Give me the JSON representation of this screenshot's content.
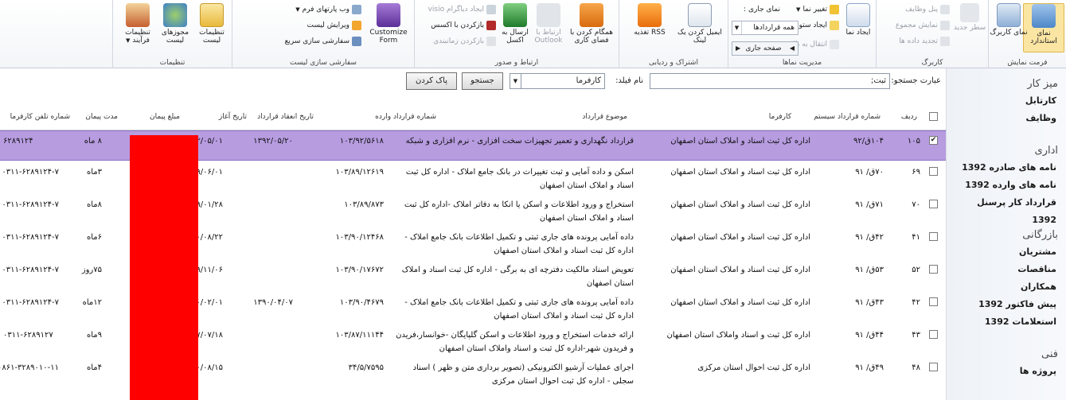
{
  "ribbon": {
    "groups": {
      "view_format": "فرمت نمایش",
      "datasheet": "کاربرگ",
      "manage_views": "مدیریت نماها",
      "share_track": "اشتراک و ردیابی",
      "connect_export": "ارتباط و صدور",
      "customize_list": "سفارشی سازی لیست",
      "settings": "تنظیمات"
    },
    "standard_view": "نمای استاندارد",
    "datasheet_view": "نمای کاربرگ",
    "new_row": "سطر جدید",
    "show_taskpane": "پنل وظایف",
    "show_totals": "نمایش مجموع",
    "refresh_data": "تجدید داده ها",
    "create_view": "ایجاد نما",
    "modify_view": "تغییر نما",
    "create_column": "ایجاد ستون",
    "navigate_up": "انتقال به بالا",
    "current_view_label": "نمای جاری :",
    "current_view_value": "همه قراردادها",
    "current_page": "صفحه جاری",
    "email_link": "ایمیل کردن یک لینک",
    "rss_feed": "RSS تغذیه",
    "sync_sharepoint": "همگام کردن با فضای کاری",
    "connect_outlook": "ارتباط با Outlook",
    "export_excel": "ارسال به اکسل",
    "visio_diagram": "ایجاد دیاگرام visio",
    "open_access": "بازکردن با اکسس",
    "open_project": "بازکردن زمانبندی",
    "customize_form": "Customize Form",
    "form_webparts": "وب پارتهای فرم",
    "edit_list": "ویرایش لیست",
    "quick_customize": "سفارشی سازی سریع",
    "list_settings": "تنظیمات لیست",
    "list_permissions": "مجوزهای لیست",
    "workflow_settings": "تنظیمات فرآیند"
  },
  "nav": {
    "sections": [
      {
        "heading": "میز کار",
        "items": [
          "کارتابل",
          "وظایف"
        ]
      },
      {
        "heading": "اداری",
        "items": [
          "نامه های صادره 1392",
          "نامه های وارده 1392",
          "قرارداد کار پرسنل 1392"
        ]
      },
      {
        "heading": "بازرگانی",
        "items": [
          "مشتریان",
          "مناقصات",
          "همکاران",
          "پیش فاکتور 1392",
          "استعلامات 1392"
        ]
      },
      {
        "heading": "فنی",
        "items": [
          "پروژه ها"
        ]
      }
    ]
  },
  "search": {
    "phrase_label": "عبارت جستجو:",
    "phrase_value": "ثبت;",
    "field_label": "نام فیلد:",
    "field_value": "کارفرما",
    "search_button": "جستجو",
    "clear_button": "پاک کردن"
  },
  "table": {
    "headers": {
      "row": "ردیف",
      "sys_no": "شماره قرارداد سیستم",
      "employer": "کارفرما",
      "subject": "موضوع قرارداد",
      "incoming_no": "شماره قرارداد وارده",
      "sign_date": "تاریخ انعقاد قرارداد",
      "start_date": "تاریخ آغاز",
      "amount": "مبلغ پیمان",
      "duration": "مدت پیمان",
      "phone": "شماره تلفن کارفرما"
    },
    "rows": [
      {
        "checked": "✔",
        "row": "۱۰۵",
        "sys_no": "۱۰۴ق/۹۲",
        "employer": "اداره کل ثبت اسناد و املاک استان اصفهان",
        "subject": "قرارداد نگهداری و تعمیر تجهیزات سخت افزاری - نرم افزاری و شبکه",
        "incoming_no": "۱۰۳/۹۲/۵۶۱۸",
        "sign_date": "۱۳۹۲/۰۵/۲۰",
        "start_date": "۱۳۹۲/۰۵/۰۱",
        "duration": "۸ ماه",
        "phone": "۶۲۸۹۱۲۴"
      },
      {
        "checked": "",
        "row": "۶۹",
        "sys_no": "۷۰ق/ ۹۱",
        "employer": "اداره کل ثبت اسناد و املاک استان اصفهان",
        "subject": "اسکن و داده آمایی و ثبت تغییرات در بانک جامع املاک - اداره کل ثبت اسناد و املاک استان اصفهان",
        "incoming_no": "۱۰۳/۸۹/۱۲۶۱۹",
        "sign_date": "",
        "start_date": "۱۳۸۹/۰۶/۰۱",
        "duration": "۳ماه",
        "phone": "۰۳۱۱-۶۲۸۹۱۲۴-۷"
      },
      {
        "checked": "",
        "row": "۷۰",
        "sys_no": "۷۱ق/ ۹۱",
        "employer": "اداره کل ثبت اسناد و املاک استان اصفهان",
        "subject": "استخراج و ورود اطلاعات و اسکن یا انکا به دفاتر املاک -اداره کل ثبت اسناد و املاک استان اصفهان",
        "incoming_no": "۱۰۳/۸۹/۸۷۳",
        "sign_date": "",
        "start_date": "۱۳۸۹/۰۱/۲۸",
        "duration": "۸ماه",
        "phone": "۰۳۱۱-۶۲۸۹۱۲۴-۷"
      },
      {
        "checked": "",
        "row": "۴۱",
        "sys_no": "۴۲ق/ ۹۱",
        "employer": "اداره کل ثبت اسناد و املاک استان اصفهان",
        "subject": "داده آمایی پرونده های جاری ثبتی و تکمیل اطلاعات بانک جامع املاک - اداره کل ثبت اسناد و املاک استان اصفهان",
        "incoming_no": "۱۰۳/۹۰/۱۲۴۶۸",
        "sign_date": "",
        "start_date": "۱۳۹۰/۰۸/۲۲",
        "duration": "۶ماه",
        "phone": "۰۳۱۱-۶۲۸۹۱۲۴-۷"
      },
      {
        "checked": "",
        "row": "۵۲",
        "sys_no": "۵۳ق/ ۹۱",
        "employer": "اداره کل ثبت اسناد و املاک استان اصفهان",
        "subject": "تعویض اسناد مالکیت دفترچه ای به برگی - اداره کل ثبت اسناد و املاک استان اصفهان",
        "incoming_no": "۱۰۳/۹۰/۱۷۶۷۲",
        "sign_date": "",
        "start_date": "۱۳۸۹/۱۱/۰۶",
        "duration": "۷۵روز",
        "phone": "۰۳۱۱-۶۲۸۹۱۲۴-۷"
      },
      {
        "checked": "",
        "row": "۴۲",
        "sys_no": "۴۳ق/ ۹۱",
        "employer": "اداره کل ثبت اسناد و املاک استان اصفهان",
        "subject": "داده آمایی پرونده های جاری ثبتی و تکمیل اطلاعات بانک جامع املاک - اداره کل ثبت اسناد و املاک استان اصفهان",
        "incoming_no": "۱۰۳/۹۰/۴۶۷۹",
        "sign_date": "۱۳۹۰/۰۴/۰۷",
        "start_date": "۱۳۹۰/۰۲/۰۱",
        "duration": "۱۲ماه",
        "phone": "۰۳۱۱-۶۲۸۹۱۲۴-۷"
      },
      {
        "checked": "",
        "row": "۴۳",
        "sys_no": "۴۴ق/ ۹۱",
        "employer": "اداره کل ثبت و اسناد واملاک استان اصفهان",
        "subject": "ارائه خدمات استخراج و ورود اطلاعات و اسکن گلپایگان -خوانسار،فریدن و فریدون شهر-اداره کل ثبت و اسناد واملاک استان اصفهان",
        "incoming_no": "۱۰۳/۸۷/۱۱۱۴۴",
        "sign_date": "",
        "start_date": "۱۳۸۷/۰۷/۱۸",
        "duration": "۹ماه",
        "phone": "۰۳۱۱-۶۲۸۹۱۲۷"
      },
      {
        "checked": "",
        "row": "۴۸",
        "sys_no": "۴۹ق/ ۹۱",
        "employer": "اداره کل ثبت احوال استان مرکزی",
        "subject": "اجرای عملیات آرشیو الکترونیکی (تصویر برداری متن و ظهر ) اسناد سجلی - اداره کل ثبت احوال استان مرکزی",
        "incoming_no": "۳۴/۵/۷۵۹۵",
        "sign_date": "",
        "start_date": "۱۳۹۰/۰۸/۱۵",
        "duration": "۴ماه",
        "phone": "۰۸۶۱-۳۲۸۹۰۱۰-۱۱"
      }
    ]
  },
  "colors": {
    "selected_row": "#b79ce0",
    "redaction": "#ff0000",
    "ribbon_selected": "#fbe5a3"
  }
}
